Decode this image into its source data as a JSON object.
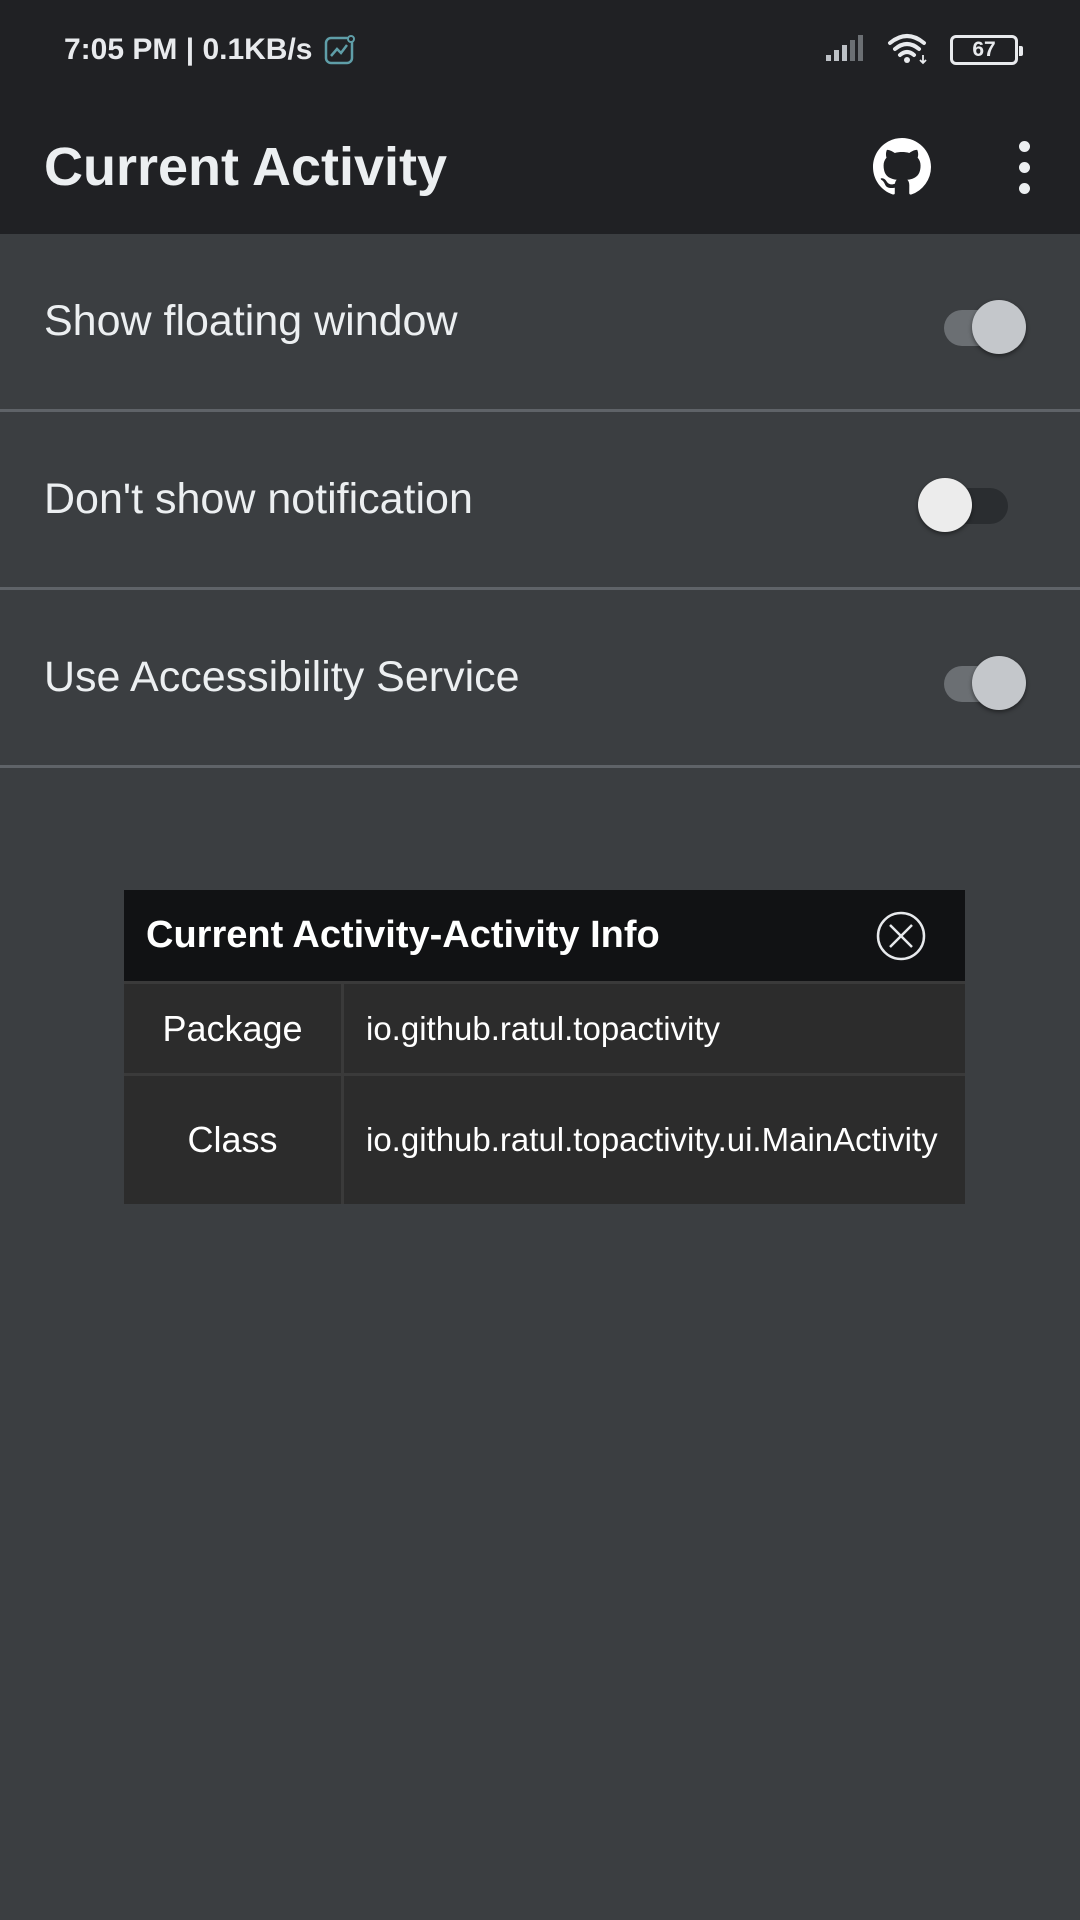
{
  "status_bar": {
    "time_and_speed": "7:05 PM | 0.1KB/s",
    "battery": "67",
    "icons": [
      "net-activity-icon",
      "signal-icon",
      "wifi-icon",
      "battery-icon"
    ]
  },
  "app_bar": {
    "title": "Current Activity",
    "actions": [
      "github-icon",
      "more-options-icon"
    ]
  },
  "settings": [
    {
      "label": "Show floating window",
      "enabled": true
    },
    {
      "label": "Don't show notification",
      "enabled": false
    },
    {
      "label": "Use Accessibility Service",
      "enabled": true
    }
  ],
  "floating_window": {
    "title": "Current Activity-Activity Info",
    "rows": [
      {
        "key": "Package",
        "value": "io.github.ratul.topactivity"
      },
      {
        "key": "Class",
        "value": "io.github.ratul.topactivity.ui.MainActivity"
      }
    ]
  },
  "colors": {
    "background": "#3b3e41",
    "app_bar": "#202124",
    "popup_header": "#111214",
    "popup_body": "#2c2c2c"
  }
}
